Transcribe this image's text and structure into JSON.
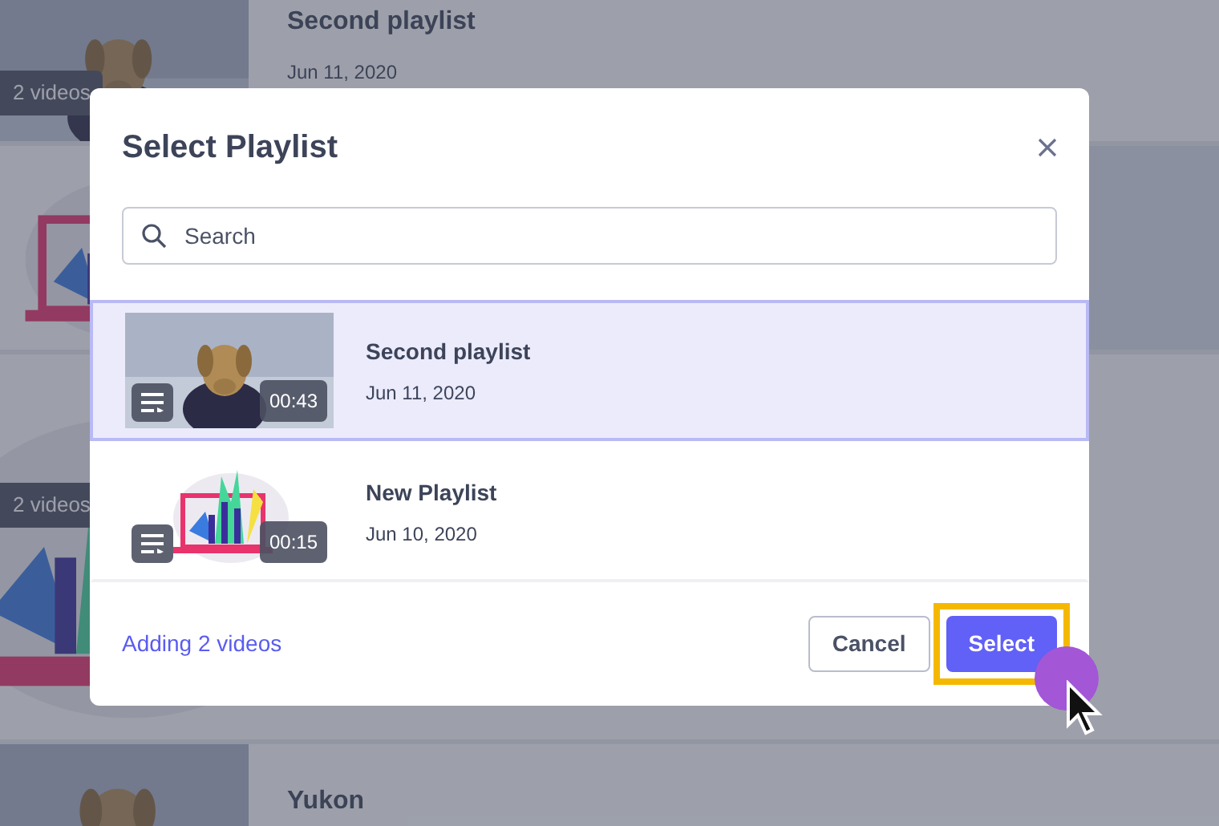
{
  "background_list": [
    {
      "badge": "2 videos",
      "title": "Second playlist",
      "date": "Jun 11, 2020"
    },
    {
      "kind": "illustration"
    },
    {
      "kind": "illustration",
      "badge": "2 videos"
    },
    {
      "title": "Yukon"
    }
  ],
  "dialog": {
    "title": "Select Playlist",
    "search": {
      "placeholder": "Search"
    },
    "playlists": [
      {
        "title": "Second playlist",
        "date": "Jun 11, 2020",
        "duration": "00:43",
        "selected": true
      },
      {
        "kind": "illustration",
        "title": "New Playlist",
        "date": "Jun 10, 2020",
        "duration": "00:15",
        "selected": false
      }
    ],
    "footer_link": "Adding 2 videos",
    "buttons": [
      {
        "label": "Cancel",
        "kind": "secondary",
        "highlighted": false
      },
      {
        "label": "Select",
        "kind": "primary",
        "highlighted": true
      }
    ]
  }
}
